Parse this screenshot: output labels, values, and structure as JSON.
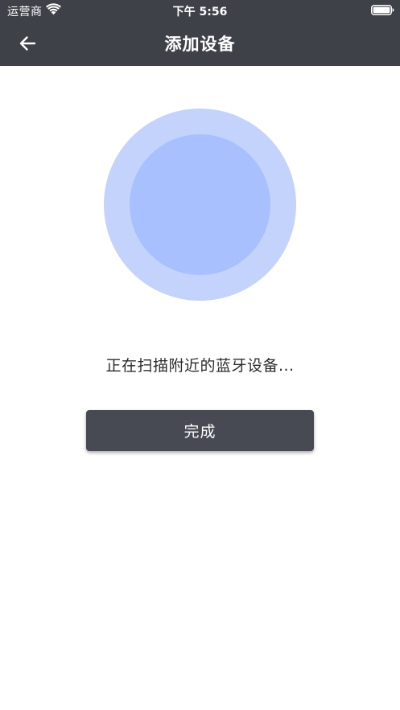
{
  "status_bar": {
    "carrier": "运营商",
    "time": "下午 5:56",
    "wifi_icon": "wifi-icon",
    "battery_icon": "battery-icon"
  },
  "nav": {
    "back_icon": "arrow-left-icon",
    "title": "添加设备"
  },
  "scan": {
    "outer_color": "#c3d3fc",
    "inner_color": "#a8c0fd",
    "status_text": "正在扫描附近的蓝牙设备..."
  },
  "actions": {
    "done_label": "完成"
  },
  "colors": {
    "header_bg": "#3f4148",
    "button_bg": "#474a53"
  }
}
